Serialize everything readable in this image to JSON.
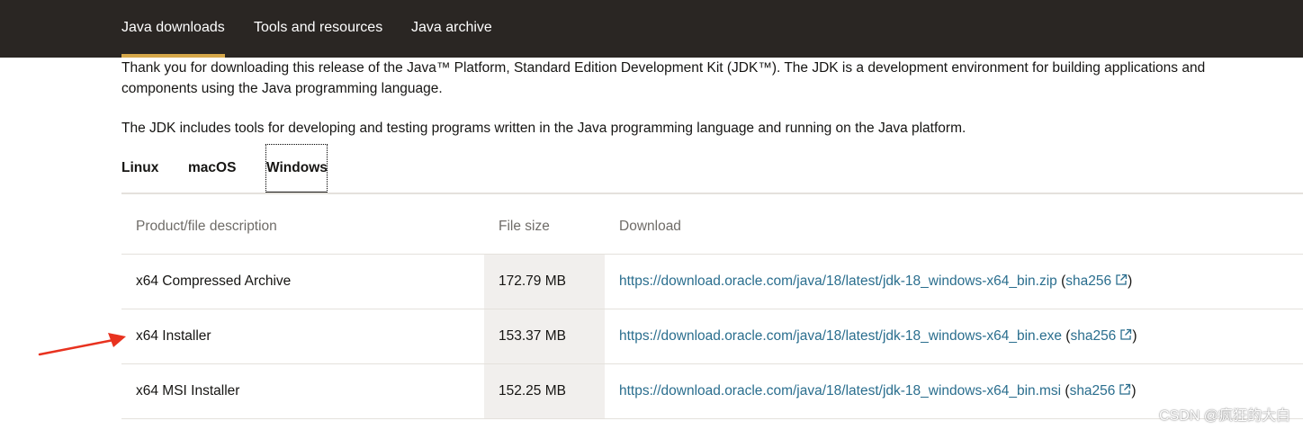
{
  "nav": {
    "items": [
      {
        "label": "Java downloads",
        "active": true
      },
      {
        "label": "Tools and resources",
        "active": false
      },
      {
        "label": "Java archive",
        "active": false
      }
    ],
    "background": "#2a2623",
    "accent": "#d6a84a"
  },
  "intro": {
    "line1": "Thank you for downloading this release of the Java™ Platform, Standard Edition Development Kit (JDK™). The JDK is a development environment for building applications and components using the Java programming language.",
    "line2": "The JDK includes tools for developing and testing programs written in the Java programming language and running on the Java platform."
  },
  "tabs": [
    {
      "label": "Linux",
      "active": false
    },
    {
      "label": "macOS",
      "active": false
    },
    {
      "label": "Windows",
      "active": true
    }
  ],
  "table": {
    "headers": [
      "Product/file description",
      "File size",
      "Download"
    ],
    "rows": [
      {
        "description": "x64 Compressed Archive",
        "size": "172.79 MB",
        "url": "https://download.oracle.com/java/18/latest/jdk-18_windows-x64_bin.zip",
        "checksum": "sha256"
      },
      {
        "description": "x64 Installer",
        "size": "153.37 MB",
        "url": "https://download.oracle.com/java/18/latest/jdk-18_windows-x64_bin.exe",
        "checksum": "sha256"
      },
      {
        "description": "x64 MSI Installer",
        "size": "152.25 MB",
        "url": "https://download.oracle.com/java/18/latest/jdk-18_windows-x64_bin.msi",
        "checksum": "sha256"
      }
    ],
    "link_color": "#2a6e8e"
  },
  "annotation": {
    "arrow_icon": "red-arrow-icon",
    "arrow_color": "#e8321f"
  },
  "watermark": "CSDN @疯狂的大白"
}
